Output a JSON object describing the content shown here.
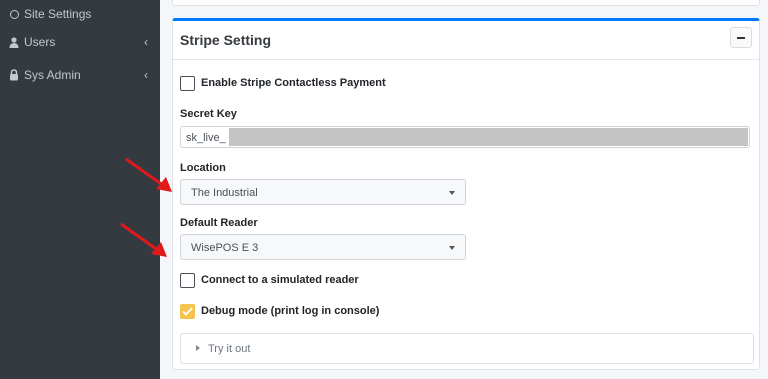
{
  "sidebar": {
    "items": [
      {
        "label": "Site Settings",
        "icon": "circle-icon"
      },
      {
        "label": "Users",
        "icon": "user-icon",
        "chevron": "‹"
      },
      {
        "label": "Sys Admin",
        "icon": "lock-icon",
        "chevron": "‹"
      }
    ]
  },
  "card": {
    "title": "Stripe Setting",
    "collapse_icon": "minus-icon",
    "enable_contactless_label": "Enable Stripe Contactless Payment",
    "enable_contactless_checked": false,
    "secret_key": {
      "label": "Secret Key",
      "value": "sk_live_"
    },
    "location": {
      "label": "Location",
      "selected": "The Industrial"
    },
    "default_reader": {
      "label": "Default Reader",
      "selected": "WisePOS E 3"
    },
    "simulated_reader_label": "Connect to a simulated reader",
    "simulated_reader_checked": false,
    "debug_label": "Debug mode (print log in console)",
    "debug_checked": true,
    "try_it_out": "Try it out"
  },
  "colors": {
    "sidebar_bg": "#343a40",
    "card_accent": "#007bff",
    "checkbox_checked": "#f5c44e",
    "annotation_arrow": "#e0191b"
  }
}
